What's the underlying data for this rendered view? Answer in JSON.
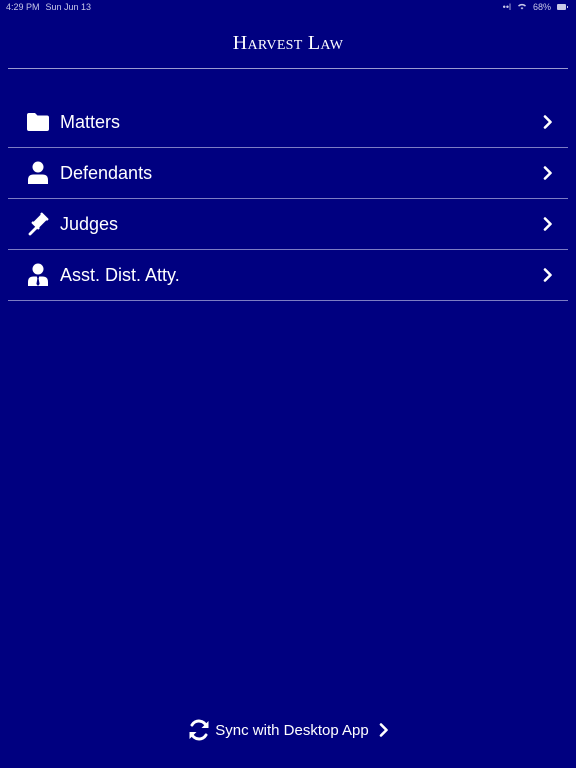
{
  "status_bar": {
    "time": "4:29 PM",
    "date": "Sun Jun 13",
    "signal": "••l",
    "battery": "68%"
  },
  "header": {
    "title": "Harvest Law"
  },
  "menu": {
    "items": [
      {
        "label": "Matters",
        "icon": "folder-icon"
      },
      {
        "label": "Defendants",
        "icon": "user-icon"
      },
      {
        "label": "Judges",
        "icon": "gavel-icon"
      },
      {
        "label": "Asst. Dist. Atty.",
        "icon": "user-tie-icon"
      }
    ]
  },
  "sync": {
    "label": "Sync with Desktop App",
    "icon": "sync-icon"
  },
  "colors": {
    "background": "#000080",
    "text": "#ffffff",
    "divider": "#7c7cc4"
  }
}
